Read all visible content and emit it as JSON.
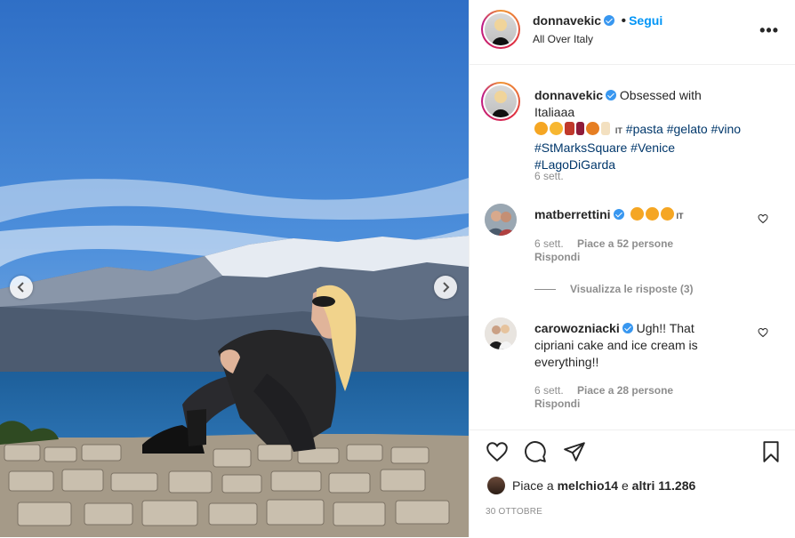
{
  "post": {
    "username": "donnavekic",
    "follow_label": "Segui",
    "location": "All Over Italy",
    "more_label": "•••"
  },
  "caption": {
    "username": "donnavekic",
    "text": "Obsessed with Italiaaa",
    "flag": "IT",
    "hashtags": [
      "#pasta",
      "#gelato",
      "#vino",
      "#StMarksSquare",
      "#Venice",
      "#LagoDiGarda"
    ],
    "time": "6 sett."
  },
  "comments": [
    {
      "username": "matberrettini",
      "text": "",
      "emoji_count": 3,
      "flag": "IT",
      "time": "6 sett.",
      "likes": "Piace a 52 persone",
      "reply": "Rispondi"
    },
    {
      "username": "carowozniacki",
      "text": "Ugh!! That cipriani cake and ice cream is everything!!",
      "time": "6 sett.",
      "likes": "Piace a 28 persone",
      "reply": "Rispondi"
    }
  ],
  "view_replies": "Visualizza le risposte (3)",
  "likes_line": {
    "prefix": "Piace a",
    "user": "melchio14",
    "joiner": "e",
    "others": "altri 11.286"
  },
  "date": "30 OTTOBRE",
  "colors": {
    "link": "#0095f6",
    "hashtag": "#00376b",
    "muted": "#8e8e8e",
    "verified": "#3897f0"
  },
  "icons": [
    "chevron-left-icon",
    "chevron-right-icon",
    "heart-icon",
    "comment-icon",
    "share-icon",
    "bookmark-icon",
    "verified-icon",
    "more-icon"
  ]
}
